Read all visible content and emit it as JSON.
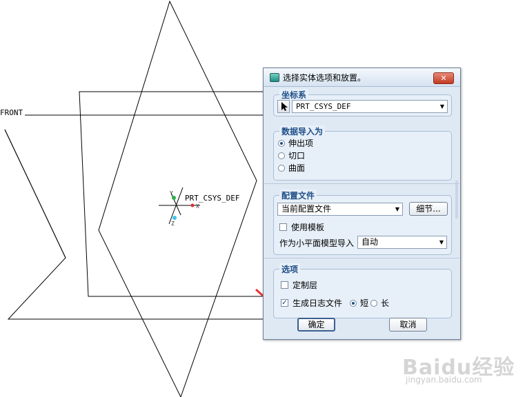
{
  "canvas": {
    "front_label": "FRONT",
    "csys_label": "PRT_CSYS_DEF",
    "axis_x": "X",
    "axis_y": "Y",
    "axis_z": "Z"
  },
  "dialog": {
    "title": "选择实体选项和放置。",
    "close_label": "✕",
    "csys_group": {
      "title": "坐标系",
      "selected": "PRT_CSYS_DEF"
    },
    "import_group": {
      "title": "数据导入为",
      "options": [
        "伸出项",
        "切口",
        "曲面"
      ],
      "selected_index": 0
    },
    "config_group": {
      "title": "配置文件",
      "config_value": "当前配置文件",
      "details_label": "细节...",
      "use_template_label": "使用模板",
      "facet_import_label": "作为小平面模型导入",
      "facet_import_value": "自动"
    },
    "options_group": {
      "title": "选项",
      "custom_layer_label": "定制层",
      "log_label": "生成日志文件",
      "log_short_label": "短",
      "log_long_label": "长"
    },
    "ok_label": "确定",
    "cancel_label": "取消"
  },
  "colors": {
    "dialog_bg": "#dfe9f4",
    "group_title": "#1e4e87",
    "arrow": "#e8322e"
  },
  "watermark": {
    "brand": "Baidu经验",
    "url": "jingyan.baidu.com"
  }
}
